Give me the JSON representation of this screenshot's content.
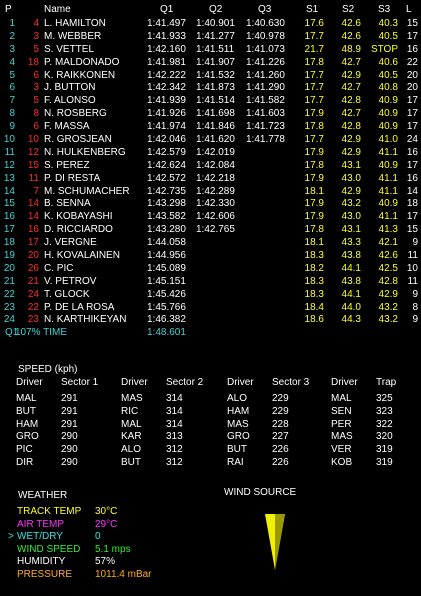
{
  "header": {
    "p": "P",
    "name": "Name",
    "q1": "Q1",
    "q2": "Q2",
    "q3": "Q3",
    "s1": "S1",
    "s2": "S2",
    "s3": "S3",
    "l": "L"
  },
  "rows": [
    {
      "p": "1",
      "no": "4",
      "name": "L. HAMILTON",
      "q1": "1:41.497",
      "q2": "1:40.901",
      "q3": "1:40.630",
      "s1": "17.6",
      "s2": "42.6",
      "s3": "40.3",
      "l": "15"
    },
    {
      "p": "2",
      "no": "3",
      "name": "M. WEBBER",
      "q1": "1:41.933",
      "q2": "1:41.277",
      "q3": "1:40.978",
      "s1": "17.7",
      "s2": "42.6",
      "s3": "40.5",
      "l": "17"
    },
    {
      "p": "3",
      "no": "5",
      "name": "S. VETTEL",
      "q1": "1:42.160",
      "q2": "1:41.511",
      "q3": "1:41.073",
      "s1": "21.7",
      "s2": "48.9",
      "s3": "STOP",
      "l": "16"
    },
    {
      "p": "4",
      "no": "18",
      "name": "P. MALDONADO",
      "q1": "1:41.981",
      "q2": "1:41.907",
      "q3": "1:41.226",
      "s1": "17.8",
      "s2": "42.7",
      "s3": "40.6",
      "l": "22"
    },
    {
      "p": "5",
      "no": "6",
      "name": "K. RAIKKONEN",
      "q1": "1:42.222",
      "q2": "1:41.532",
      "q3": "1:41.260",
      "s1": "17.7",
      "s2": "42.9",
      "s3": "40.5",
      "l": "20"
    },
    {
      "p": "6",
      "no": "3",
      "name": "J. BUTTON",
      "q1": "1:42.342",
      "q2": "1:41.873",
      "q3": "1:41.290",
      "s1": "17.7",
      "s2": "42.7",
      "s3": "40.8",
      "l": "20"
    },
    {
      "p": "7",
      "no": "5",
      "name": "F. ALONSO",
      "q1": "1:41.939",
      "q2": "1:41.514",
      "q3": "1:41.582",
      "s1": "17.7",
      "s2": "42.8",
      "s3": "40.9",
      "l": "17"
    },
    {
      "p": "8",
      "no": "8",
      "name": "N. ROSBERG",
      "q1": "1:41.926",
      "q2": "1:41.698",
      "q3": "1:41.603",
      "s1": "17.9",
      "s2": "42.7",
      "s3": "40.9",
      "l": "17"
    },
    {
      "p": "9",
      "no": "6",
      "name": "F. MASSA",
      "q1": "1:41.974",
      "q2": "1:41.846",
      "q3": "1:41.723",
      "s1": "17.8",
      "s2": "42.8",
      "s3": "40.9",
      "l": "17"
    },
    {
      "p": "10",
      "no": "10",
      "name": "R. GROSJEAN",
      "q1": "1:42.046",
      "q2": "1:41.620",
      "q3": "1:41.778",
      "s1": "17.7",
      "s2": "42.9",
      "s3": "41.0",
      "l": "24"
    },
    {
      "p": "11",
      "no": "12",
      "name": "N. HULKENBERG",
      "q1": "1:42.579",
      "q2": "1:42.019",
      "q3": "",
      "s1": "17.9",
      "s2": "42.9",
      "s3": "41.1",
      "l": "16"
    },
    {
      "p": "12",
      "no": "15",
      "name": "S. PEREZ",
      "q1": "1:42.624",
      "q2": "1:42.084",
      "q3": "",
      "s1": "17.8",
      "s2": "43.1",
      "s3": "40.9",
      "l": "17"
    },
    {
      "p": "13",
      "no": "11",
      "name": "P. DI RESTA",
      "q1": "1:42.572",
      "q2": "1:42.218",
      "q3": "",
      "s1": "17.9",
      "s2": "43.0",
      "s3": "41.1",
      "l": "16"
    },
    {
      "p": "14",
      "no": "7",
      "name": "M. SCHUMACHER",
      "q1": "1:42.735",
      "q2": "1:42.289",
      "q3": "",
      "s1": "18.1",
      "s2": "42.9",
      "s3": "41.1",
      "l": "14"
    },
    {
      "p": "15",
      "no": "14",
      "name": "B. SENNA",
      "q1": "1:43.298",
      "q2": "1:42.330",
      "q3": "",
      "s1": "17.9",
      "s2": "43.2",
      "s3": "40.9",
      "l": "18"
    },
    {
      "p": "16",
      "no": "14",
      "name": "K. KOBAYASHI",
      "q1": "1:43.582",
      "q2": "1:42.606",
      "q3": "",
      "s1": "17.9",
      "s2": "43.0",
      "s3": "41.1",
      "l": "17"
    },
    {
      "p": "17",
      "no": "16",
      "name": "D. RICCIARDO",
      "q1": "1:43.280",
      "q2": "1:42.765",
      "q3": "",
      "s1": "17.8",
      "s2": "43.1",
      "s3": "41.3",
      "l": "15"
    },
    {
      "p": "18",
      "no": "17",
      "name": "J. VERGNE",
      "q1": "1:44.058",
      "q2": "",
      "q3": "",
      "s1": "18.1",
      "s2": "43.3",
      "s3": "42.1",
      "l": "9"
    },
    {
      "p": "19",
      "no": "20",
      "name": "H. KOVALAINEN",
      "q1": "1:44.956",
      "q2": "",
      "q3": "",
      "s1": "18.3",
      "s2": "43.8",
      "s3": "42.6",
      "l": "11"
    },
    {
      "p": "20",
      "no": "26",
      "name": "C. PIC",
      "q1": "1:45.089",
      "q2": "",
      "q3": "",
      "s1": "18.2",
      "s2": "44.1",
      "s3": "42.5",
      "l": "10"
    },
    {
      "p": "21",
      "no": "21",
      "name": "V. PETROV",
      "q1": "1:45.151",
      "q2": "",
      "q3": "",
      "s1": "18.3",
      "s2": "43.8",
      "s3": "42.8",
      "l": "11"
    },
    {
      "p": "22",
      "no": "24",
      "name": "T. GLOCK",
      "q1": "1:45.426",
      "q2": "",
      "q3": "",
      "s1": "18.3",
      "s2": "44.1",
      "s3": "42.9",
      "l": "9"
    },
    {
      "p": "23",
      "no": "22",
      "name": "P. DE LA ROSA",
      "q1": "1:45.766",
      "q2": "",
      "q3": "",
      "s1": "18.4",
      "s2": "44.0",
      "s3": "43.2",
      "l": "8"
    },
    {
      "p": "24",
      "no": "23",
      "name": "N. KARTHIKEYAN",
      "q1": "1:46.382",
      "q2": "",
      "q3": "",
      "s1": "18.6",
      "s2": "44.3",
      "s3": "43.2",
      "l": "9"
    }
  ],
  "q1_time": {
    "p": "Q1",
    "label": "107% TIME",
    "value": "1:48.601"
  },
  "speed": {
    "title": "SPEED (kph)",
    "headers": [
      "Driver",
      "Sector 1",
      "Driver",
      "Sector 2",
      "Driver",
      "Sector 3",
      "Driver",
      "Trap"
    ],
    "rows": [
      [
        "MAL",
        "291",
        "MAS",
        "314",
        "ALO",
        "229",
        "MAL",
        "325"
      ],
      [
        "BUT",
        "291",
        "RIC",
        "314",
        "HAM",
        "229",
        "SEN",
        "323"
      ],
      [
        "HAM",
        "291",
        "MAL",
        "314",
        "MAS",
        "228",
        "PER",
        "322"
      ],
      [
        "GRO",
        "290",
        "KAR",
        "313",
        "GRO",
        "227",
        "MAS",
        "320"
      ],
      [
        "PIC",
        "290",
        "ALO",
        "312",
        "BUT",
        "226",
        "VER",
        "319"
      ],
      [
        "DIR",
        "290",
        "BUT",
        "312",
        "RAI",
        "226",
        "KOB",
        "319"
      ]
    ]
  },
  "weather": {
    "title": "WEATHER",
    "wind_source_title": "WIND SOURCE",
    "items": [
      {
        "prefix": "",
        "label": "TRACK TEMP",
        "value": "30°C",
        "color": "#ffff22"
      },
      {
        "prefix": "",
        "label": "AIR TEMP",
        "value": "29°C",
        "color": "#ff33ff"
      },
      {
        "prefix": ">",
        "label": "WET/DRY",
        "value": "0",
        "color": "#33e0e0"
      },
      {
        "prefix": "",
        "label": "WIND SPEED",
        "value": "5.1 mps",
        "color": "#33ee33"
      },
      {
        "prefix": "",
        "label": "HUMIDITY",
        "value": "57%",
        "color": "#ffffff"
      },
      {
        "prefix": "",
        "label": "PRESSURE",
        "value": "1011.4 mBar",
        "color": "#ffb020"
      }
    ]
  },
  "colors": {
    "position": "#3fd3d3",
    "car_number": "#ff2a2a",
    "sector": "#ffff22",
    "wind_arrow": "#f0f000"
  }
}
